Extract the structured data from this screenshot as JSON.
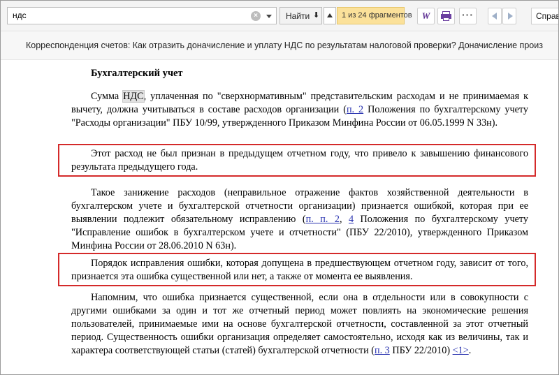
{
  "toolbar": {
    "search_value": "ндс",
    "clear_glyph": "×",
    "find_label": "Найти",
    "find_arrow": "⬇",
    "match_count": "1 из 24 фрагментов",
    "w_glyph": "W",
    "more_glyph": "···",
    "help_label": "Справ"
  },
  "breadcrumb": {
    "text": "Корреспонденция счетов: Как отразить доначисление и уплату НДС по результатам налоговой проверки? Доначисление произ"
  },
  "document": {
    "heading": "Бухгалтерский учет",
    "p1": {
      "t1": "Сумма ",
      "hl": "НДС",
      "t2": ", уплаченная по \"сверхнормативным\" представительским расходам и не принимаемая к вычету, должна учитываться в составе расходов организации (",
      "link1": "п. 2",
      "t3": " Положения по бухгалтерскому учету \"Расходы организации\" ПБУ 10/99, утвержденного Приказом Минфина России от 06.05.1999 N 33н)."
    },
    "p2": "Этот расход не был признан в предыдущем отчетном году, что привело к завышению финансового результата предыдущего года.",
    "p3": {
      "t1": "Такое занижение расходов (неправильное отражение фактов хозяйственной деятельности в бухгалтерском учете и бухгалтерской отчетности организации) признается ошибкой, которая при ее выявлении подлежит обязательному исправлению (",
      "link1": "п. п. 2",
      "sep": ", ",
      "link2": "4",
      "t2": " Положения по бухгалтерскому учету \"Исправление ошибок в бухгалтерском учете и отчетности\" (ПБУ 22/2010), утвержденного Приказом Минфина России от 28.06.2010 N 63н)."
    },
    "p4": "Порядок исправления ошибки, которая допущена в предшествующем отчетном году, зависит от того, признается эта ошибка существенной или нет, а также от момента ее выявления.",
    "p5": {
      "t1": "Напомним, что ошибка признается существенной, если она в отдельности или в совокупности с другими ошибками за один и тот же отчетный период может повлиять на экономические решения пользователей, принимаемые ими на основе бухгалтерской отчетности, составленной за этот отчетный период. Существенность ошибки организация определяет самостоятельно, исходя как из величины, так и характера соответствующей статьи (статей) бухгалтерской отчетности (",
      "link1": "п. 3",
      "t2": " ПБУ 22/2010) ",
      "link2": "<1>",
      "t3": "."
    }
  },
  "colors": {
    "highlight_box": "#d42a2a",
    "link": "#2a34b0",
    "match_badge": "#fbe19a"
  }
}
